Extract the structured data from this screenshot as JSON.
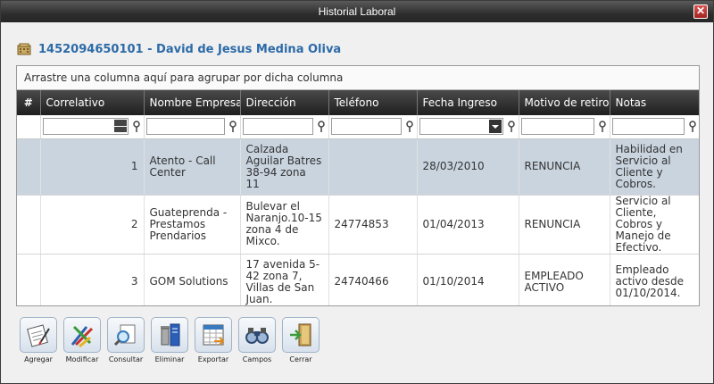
{
  "window": {
    "title": "Historial Laboral",
    "close_glyph": "✕"
  },
  "header": {
    "icon": "building-icon",
    "title": "1452094650101 - David de Jesus Medina Oliva"
  },
  "grid": {
    "group_hint": "Arrastre una columna aquí para agrupar por dicha columna",
    "columns": [
      "#",
      "Correlativo",
      "Nombre Empresa",
      "Dirección",
      "Teléfono",
      "Fecha Ingreso",
      "Motivo de retiro",
      "Notas"
    ],
    "rows": [
      {
        "correlativo": "1",
        "empresa": "Atento - Call Center",
        "direccion": "Calzada Aguilar Batres 38-94 zona 11",
        "telefono": "",
        "fecha": "28/03/2010",
        "motivo": "RENUNCIA",
        "notas": "Habilidad en Servicio al Cliente y Cobros."
      },
      {
        "correlativo": "2",
        "empresa": "Guateprenda - Prestamos Prendarios",
        "direccion": "Bulevar el Naranjo.10-15 zona 4 de Mixco.",
        "telefono": "24774853",
        "fecha": "01/04/2013",
        "motivo": "RENUNCIA",
        "notas": "Servicio al Cliente, Cobros y Manejo de Efectivo."
      },
      {
        "correlativo": "3",
        "empresa": "GOM Solutions",
        "direccion": "17 avenida 5-42 zona 7, Villas de San Juan.",
        "telefono": "24740466",
        "fecha": "01/10/2014",
        "motivo": "EMPLEADO ACTIVO",
        "notas": "Empleado activo desde 01/10/2014."
      }
    ]
  },
  "toolbar": {
    "buttons": [
      {
        "label": "Agregar",
        "icon": "add-document-icon"
      },
      {
        "label": "Modificar",
        "icon": "edit-pencil-icon"
      },
      {
        "label": "Consultar",
        "icon": "magnifier-icon"
      },
      {
        "label": "Eliminar",
        "icon": "trash-icon"
      },
      {
        "label": "Exportar",
        "icon": "export-spreadsheet-icon"
      },
      {
        "label": "Campos",
        "icon": "binoculars-icon"
      },
      {
        "label": "Cerrar",
        "icon": "exit-door-icon"
      }
    ]
  },
  "colors": {
    "title_blue": "#2c6aa8",
    "selected_row": "#c9d4df",
    "header_dark": "#1f1f1f"
  }
}
